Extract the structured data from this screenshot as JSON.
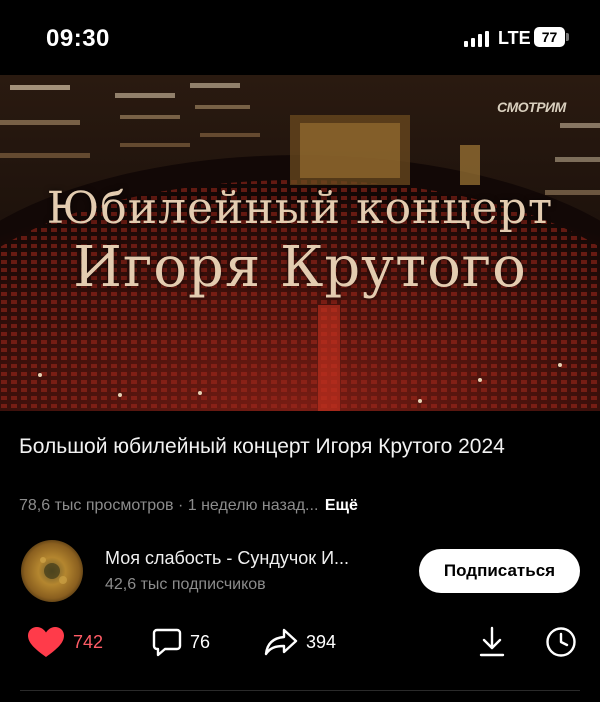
{
  "status_bar": {
    "time": "09:30",
    "network": "LTE",
    "battery": "77"
  },
  "video": {
    "logo": "СМОТРИМ",
    "title_line1": "Юбилейный концерт",
    "title_line2": "Игоря Крутого"
  },
  "title": "Большой юбилейный концерт Игоря Крутого 2024",
  "meta": {
    "views": "78,6 тыс просмотров",
    "separator": " · ",
    "age": "1 неделю назад...",
    "more": "Ещё"
  },
  "channel": {
    "name": "Моя слабость - Сундучок И...",
    "subscribers": "42,6 тыс подписчиков",
    "subscribe_label": "Подписаться"
  },
  "actions": {
    "likes": "742",
    "comments": "76",
    "shares": "394"
  },
  "colors": {
    "background": "#000000",
    "like_accent": "#ff5c66",
    "muted_text": "#8c8c8c"
  }
}
